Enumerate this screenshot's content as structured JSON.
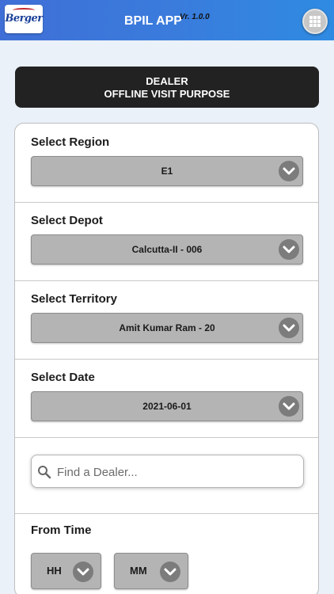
{
  "header": {
    "logo_text": "Berger",
    "title": "BPIL APP",
    "version": "Vr. 1.0.0",
    "menu_icon": "grid-icon",
    "gradient_colors": [
      "#3f6fd6",
      "#2f8be2"
    ]
  },
  "banner": {
    "line1": "DEALER",
    "line2": "OFFLINE VISIT PURPOSE"
  },
  "form": {
    "region": {
      "label": "Select Region",
      "value": "E1"
    },
    "depot": {
      "label": "Select Depot",
      "value": "Calcutta-II - 006"
    },
    "territory": {
      "label": "Select Territory",
      "value": "Amit Kumar Ram - 20"
    },
    "date": {
      "label": "Select Date",
      "value": "2021-06-01"
    },
    "search": {
      "placeholder": "Find a Dealer...",
      "icon": "search-icon"
    },
    "from_time": {
      "label": "From Time",
      "hours": "HH",
      "minutes": "MM"
    }
  }
}
